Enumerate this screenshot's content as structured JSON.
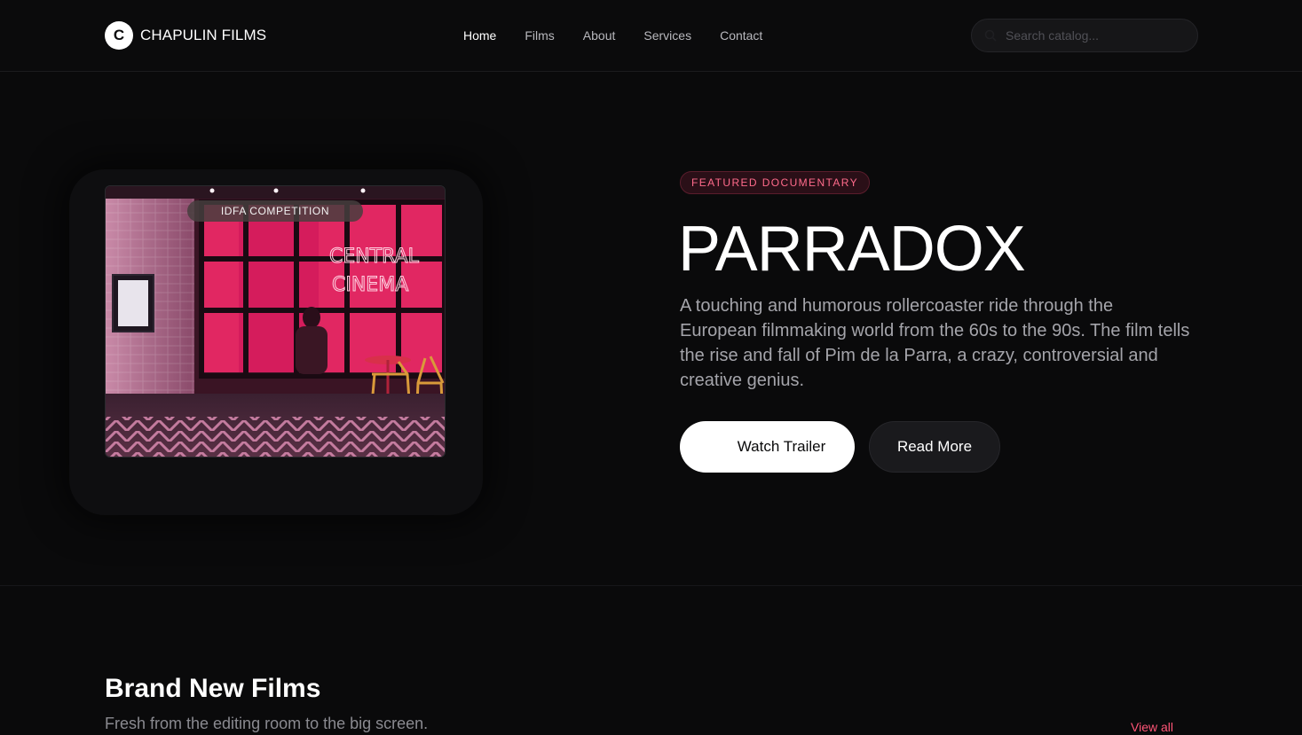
{
  "brand": {
    "logo_letter": "C",
    "name": "CHAPULIN FILMS"
  },
  "nav": {
    "items": [
      {
        "label": "Home",
        "active": true
      },
      {
        "label": "Films"
      },
      {
        "label": "About"
      },
      {
        "label": "Services"
      },
      {
        "label": "Contact"
      }
    ]
  },
  "search": {
    "placeholder": "Search catalog...",
    "value": "",
    "icon": "search-icon"
  },
  "hero": {
    "poster_badge": "IDFA COMPETITION",
    "poster_sign_line1": "CENTRAL",
    "poster_sign_line2": "CINEMA",
    "tag": "FEATURED DOCUMENTARY",
    "title": "PARRADOX",
    "description": "A touching and humorous rollercoaster ride through the European filmmaking world from the 60s to the 90s. The film tells the rise and fall of Pim de la Parra, a crazy, controversial and creative genius.",
    "primary_button": "Watch Trailer",
    "secondary_button": "Read More"
  },
  "section": {
    "title": "Brand New Films",
    "subtitle": "Fresh from the editing room to the big screen.",
    "view_all": "View all"
  },
  "colors": {
    "background": "#0a0a0b",
    "accent": "#ff5577",
    "tag_text": "#ff6b8b",
    "neon_pink": "#ff2a6d"
  }
}
